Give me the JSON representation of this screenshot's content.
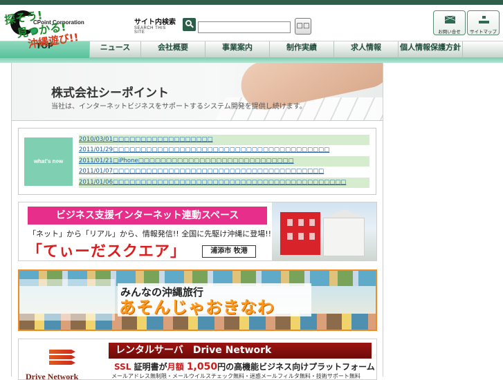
{
  "header": {
    "logo_name": "CPoint Corporation",
    "search_label_jp": "サイト内検索",
    "search_label_en": "SEARCH THIS SITE",
    "search_value": "",
    "search_button": "□□",
    "contact_label": "お問い合せ",
    "sitemap_label": "サイトマップ"
  },
  "nav": {
    "items": [
      "TOP",
      "ニュース",
      "会社概要",
      "事業案内",
      "制作実績",
      "求人情報",
      "個人情報保護方針"
    ],
    "active": "TOP"
  },
  "hero": {
    "title": "株式会社シーポイント",
    "subtitle": "当社は、インターネットビジネスをサポートするシステム開発を提供し続けます。"
  },
  "news": {
    "badge": "what's new",
    "items": [
      {
        "date": "2010/03/01",
        "title": "□□□□□□□□□□□□□□□□□□"
      },
      {
        "date": "2011/01/29",
        "title": "□□□□□□□□□□□□□□□□□□□□□□□□□□□□□□□□□□□□□□□"
      },
      {
        "date": "2011/01/21",
        "title": "□iPhone□□□□□□□□□□□□□□□□□□□□□□□□□□□□"
      },
      {
        "date": "2011/01/07",
        "title": "□□□□□□□□□□□□□□□□□□□□□□□□□□□□□□□□□□□□□□"
      },
      {
        "date": "2011/01/06",
        "title": "□□□□□□□□□□□□□□□□□□□□□□□□□□□□□□□□□□□□□□□□□□"
      }
    ]
  },
  "banner1": {
    "headline": "ビジネス支援インターネット連動スペース",
    "subline": "「ネット」から「リアル」から、情報発信!! 全国に先駆け沖縄に登場!!",
    "name": "「てぃーだスクエア」",
    "place": "浦添市 牧港"
  },
  "banner2": {
    "line1": "探そう!",
    "line2": "見つかる!",
    "line3": "沖縄遊び!!",
    "title_small": "みんなの沖縄旅行",
    "title_big": "あそんじゃおきなわ"
  },
  "banner3": {
    "logo_name": "Drive Network",
    "headline": "レンタルサーバ　Drive Network",
    "ssl": "SSL",
    "ssl_rest": "証明書が",
    "monthly": "月額",
    "price": "1,050",
    "price_rest": "円の高機能ビジネス向けプラットフォーム",
    "features": "メールアドレス無制限・メールウイルスチェック無料・迷惑メールフィルタ無料・技術サポート無料"
  }
}
